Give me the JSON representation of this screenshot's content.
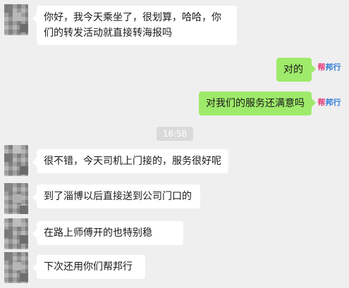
{
  "messages": [
    {
      "id": "m1",
      "side": "in",
      "text": "你好，我今天乘坐了，很划算，哈哈，你们的转发活动就直接转海报吗"
    },
    {
      "id": "m2",
      "side": "out",
      "text": "对的"
    },
    {
      "id": "m3",
      "side": "out",
      "text": "对我们的服务还满意吗"
    },
    {
      "id": "m4",
      "side": "in",
      "text": "很不错，今天司机上门接的，服务很好呢"
    },
    {
      "id": "m5",
      "side": "in",
      "text": "到了淄博以后直接送到公司门口的"
    },
    {
      "id": "m6",
      "side": "in",
      "text": "在路上师傅开的也特别稳"
    },
    {
      "id": "m7",
      "side": "in",
      "text": "下次还用你们帮邦行"
    }
  ],
  "timestamp": "16:58",
  "brand": {
    "name_part1": "帮",
    "name_part2": "邦行",
    "color1": "#e23a7a",
    "color2": "#2e7ad6"
  },
  "colors": {
    "outgoing_bubble": "#9eea6a",
    "incoming_bubble": "#ffffff",
    "background": "#efefef"
  }
}
